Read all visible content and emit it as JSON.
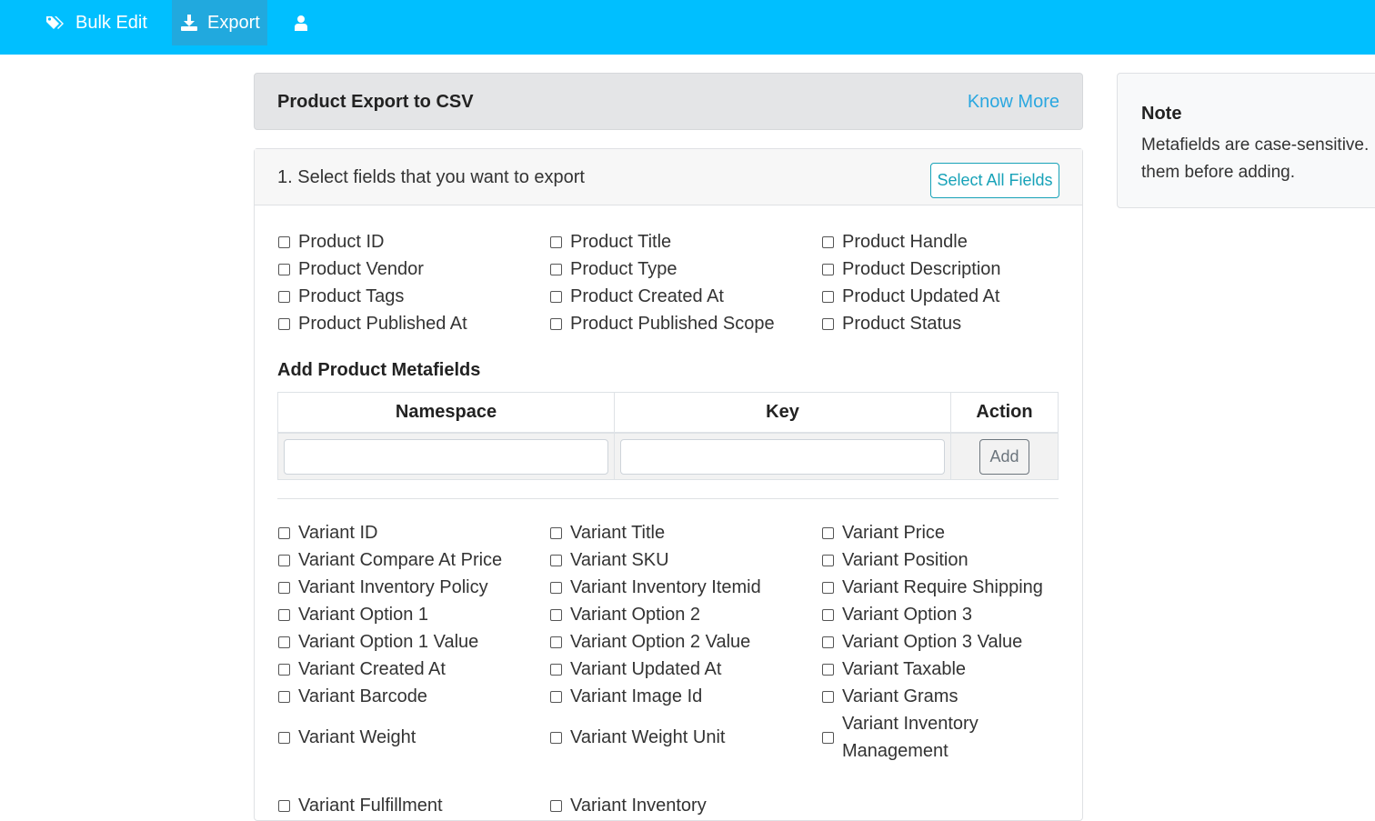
{
  "nav": {
    "bulk_edit": "Bulk Edit",
    "export": "Export",
    "user_icon": "user-icon"
  },
  "header": {
    "title": "Product Export to CSV",
    "know_more": "Know More"
  },
  "step": {
    "label": "1. Select fields that you want to export",
    "select_all": "Select All Fields"
  },
  "product_fields": [
    "Product ID",
    "Product Title",
    "Product Handle",
    "Product Vendor",
    "Product Type",
    "Product Description",
    "Product Tags",
    "Product Created At",
    "Product Updated At",
    "Product Published At",
    "Product Published Scope",
    "Product Status"
  ],
  "metafields": {
    "title": "Add Product Metafields",
    "col_namespace": "Namespace",
    "col_key": "Key",
    "col_action": "Action",
    "namespace_value": "",
    "key_value": "",
    "add_label": "Add"
  },
  "variant_fields": [
    "Variant ID",
    "Variant Title",
    "Variant Price",
    "Variant Compare At Price",
    "Variant SKU",
    "Variant Position",
    "Variant Inventory Policy",
    "Variant Inventory Itemid",
    "Variant Require Shipping",
    "Variant Option 1",
    "Variant Option 2",
    "Variant Option 3",
    "Variant Option 1 Value",
    "Variant Option 2 Value",
    "Variant Option 3 Value",
    "Variant Created At",
    "Variant Updated At",
    "Variant Taxable",
    "Variant Barcode",
    "Variant Image Id",
    "Variant Grams",
    "Variant Weight",
    "Variant Weight Unit",
    "Variant Inventory Management",
    "Variant Fulfillment",
    "Variant Inventory"
  ],
  "note": {
    "title": "Note",
    "text": "Metafields are case-sensitive. them before adding."
  },
  "colors": {
    "nav_bg": "#00bfff",
    "nav_active": "#21a9de",
    "link": "#2aa7e0",
    "info": "#17a2b8"
  }
}
